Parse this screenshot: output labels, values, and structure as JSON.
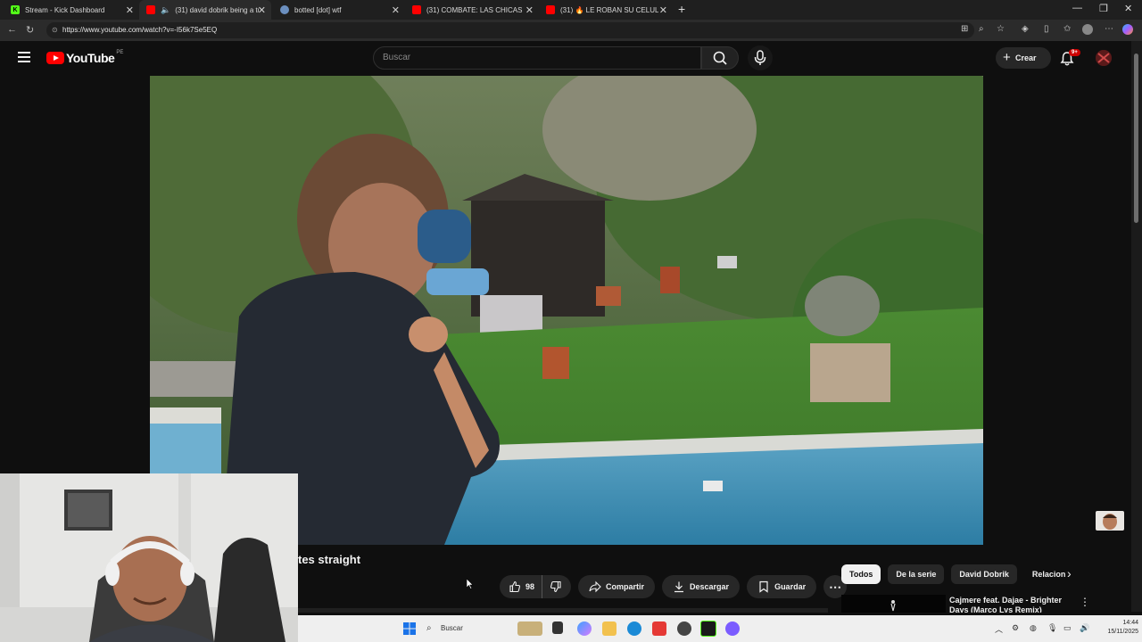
{
  "browser": {
    "tabs": [
      {
        "title": "Stream - Kick Dashboard",
        "icon": "kick-icon",
        "active": false
      },
      {
        "title": "(31) david dobrik being a tur",
        "icon": "youtube-icon",
        "active": true
      },
      {
        "title": "botted [dot] wtf",
        "icon": "globe-icon",
        "active": false
      },
      {
        "title": "(31) COMBATE: LAS CHICAS USA",
        "icon": "youtube-icon",
        "active": false
      },
      {
        "title": "(31) 🔥 LE ROBAN SU CELULAR S",
        "icon": "youtube-icon",
        "active": false
      }
    ],
    "url": "https://www.youtube.com/watch?v=-I56k7Se5EQ"
  },
  "youtube": {
    "logo_text": "YouTube",
    "region": "PE",
    "search_placeholder": "Buscar",
    "create_label": "Crear",
    "notification_count": "9+"
  },
  "video": {
    "title_fragment": "tes straight"
  },
  "actions": {
    "like_count": "98",
    "share_label": "Compartir",
    "download_label": "Descargar",
    "save_label": "Guardar"
  },
  "chips": [
    "Todos",
    "De la serie",
    "David Dobrik",
    "Relacion"
  ],
  "recommendation": {
    "title": "Cajmere feat. Dajae - Brighter Days (Marco Lys Remix)"
  },
  "taskbar": {
    "search_label": "Buscar",
    "time": "14:44",
    "date": "15/11/2025"
  },
  "colors": {
    "background": "#0f0f0f",
    "brand_red": "#ff0000",
    "pill": "#272727",
    "taskbar": "#efefef"
  }
}
